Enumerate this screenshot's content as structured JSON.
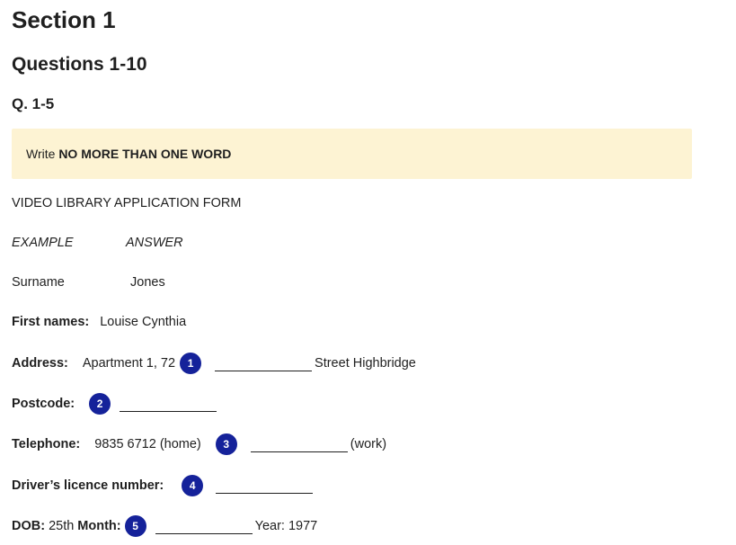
{
  "header": {
    "section_title": "Section 1",
    "questions_title": "Questions 1-10",
    "group_title": "Q. 1-5"
  },
  "instruction": {
    "prefix": "Write",
    "emphasis": "NO MORE THAN ONE WORD"
  },
  "form": {
    "title": "VIDEO LIBRARY APPLICATION FORM",
    "example_label": "EXAMPLE",
    "answer_label": "ANSWER",
    "surname_label": "Surname",
    "surname_value": "Jones",
    "first_names_label": "First names:",
    "first_names_value": "Louise Cynthia",
    "address_label": "Address:",
    "address_prefix": "Apartment 1, 72",
    "address_suffix": "Street Highbridge",
    "postcode_label": "Postcode:",
    "telephone_label": "Telephone:",
    "telephone_value": "9835 6712 (home)",
    "telephone_suffix": "(work)",
    "licence_label": "Driver’s licence number:",
    "dob_label": "DOB:",
    "dob_day": "25th",
    "dob_month_label": "Month:",
    "dob_year": "Year: 1977"
  },
  "questions": {
    "q1": "1",
    "q2": "2",
    "q3": "3",
    "q4": "4",
    "q5": "5"
  },
  "colors": {
    "question_badge": "#15229a",
    "instruction_bg": "#fdf3d3"
  }
}
